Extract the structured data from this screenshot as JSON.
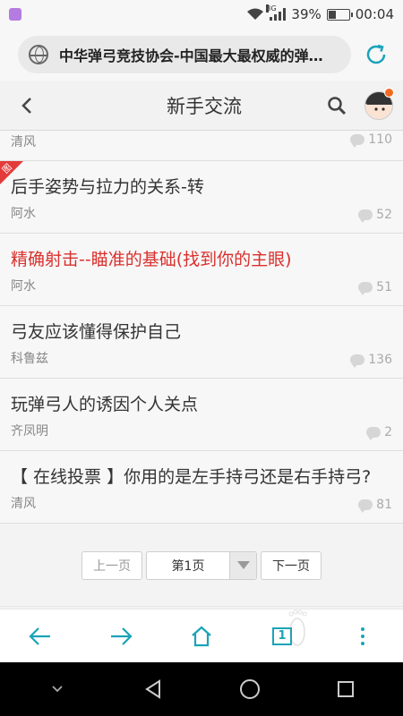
{
  "status_bar": {
    "network": "3G",
    "battery": "39%",
    "battery_level": 0.39,
    "time": "00:04"
  },
  "browser": {
    "url_title": "中华弹弓竞技协会-中国最大最权威的弹…"
  },
  "header": {
    "title": "新手交流"
  },
  "partial_thread": {
    "author": "清风",
    "replies": "110"
  },
  "threads": [
    {
      "title": "后手姿势与拉力的关系-转",
      "author": "阿水",
      "replies": "52",
      "has_image_tag": true,
      "image_tag": "图",
      "highlight": false
    },
    {
      "title": "精确射击--瞄准的基础(找到你的主眼)",
      "author": "阿水",
      "replies": "51",
      "has_image_tag": false,
      "highlight": true
    },
    {
      "title": "弓友应该懂得保护自己",
      "author": "科鲁兹",
      "replies": "136",
      "has_image_tag": false,
      "highlight": false
    },
    {
      "title": "玩弹弓人的诱因个人关点",
      "author": "齐凤明",
      "replies": "2",
      "has_image_tag": false,
      "highlight": false
    },
    {
      "title": "【 在线投票 】你用的是左手持弓还是右手持弓?",
      "author": "清风",
      "replies": "81",
      "has_image_tag": false,
      "highlight": false
    }
  ],
  "pagination": {
    "prev": "上一页",
    "current": "第1页",
    "next": "下一页"
  },
  "colors": {
    "accent": "#1aa3b9",
    "highlight_red": "#d9302c",
    "notify_dot": "#f26b21"
  }
}
